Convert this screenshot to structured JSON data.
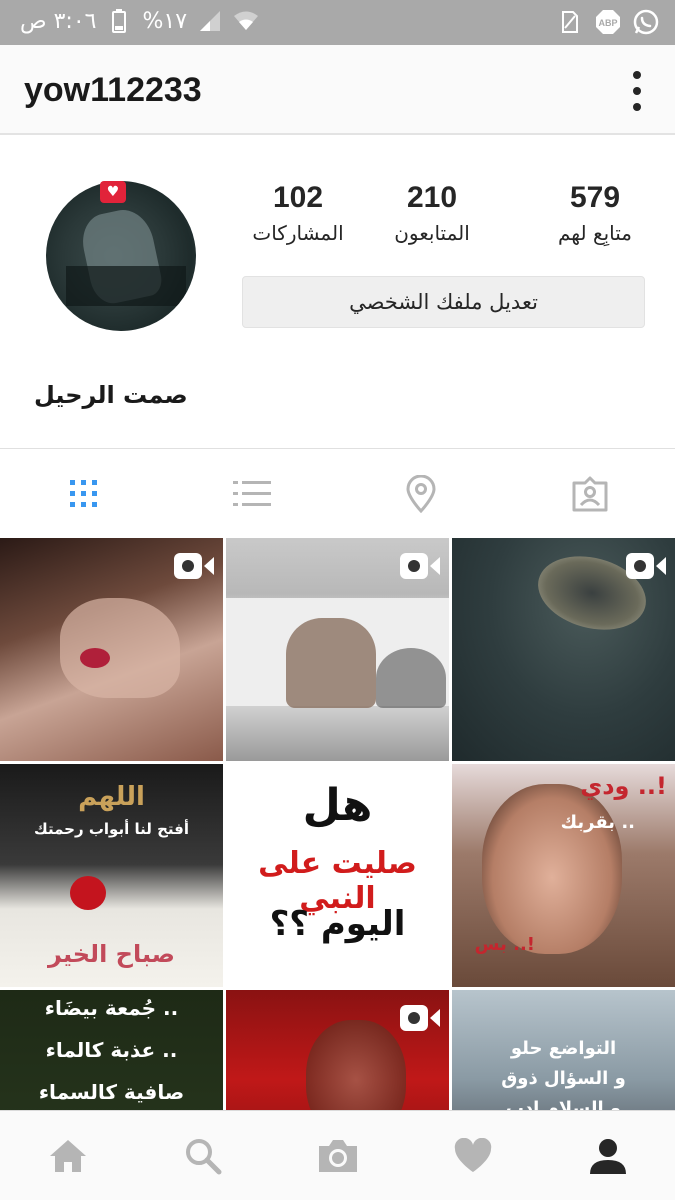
{
  "status_bar": {
    "time": "٣:٠٦ ص",
    "battery": "%١٧",
    "icons": [
      "battery-icon",
      "cell-signal-icon",
      "wifi-icon",
      "sim-icon",
      "adblock-icon",
      "whatsapp-icon"
    ],
    "abp_label": "ABP"
  },
  "header": {
    "username": "yow112233",
    "menu_icon": "more-vertical-icon"
  },
  "profile": {
    "stats": [
      {
        "value": "579",
        "label": "متابِع لهم"
      },
      {
        "value": "210",
        "label": "المتابعون"
      },
      {
        "value": "102",
        "label": "المشاركات"
      }
    ],
    "edit_button_label": "تعديل ملفك الشخصي",
    "full_name": "صمت الرحيل"
  },
  "tabs": [
    {
      "icon": "grid-view-icon",
      "active": true
    },
    {
      "icon": "list-view-icon",
      "active": false
    },
    {
      "icon": "location-pin-icon",
      "active": false
    },
    {
      "icon": "tagged-photos-icon",
      "active": false
    }
  ],
  "posts": [
    {
      "type": "video",
      "caption": ""
    },
    {
      "type": "video",
      "caption": ""
    },
    {
      "type": "video",
      "caption": ""
    },
    {
      "type": "image",
      "caption_lines": [
        "اللهم",
        "أفتح لنا أبواب رحمتك",
        "صباح الخير"
      ]
    },
    {
      "type": "image",
      "caption_lines": [
        "هل",
        "صليت على النبي",
        "اليوم ؟؟"
      ]
    },
    {
      "type": "image",
      "caption_lines": [
        "ودي ..!",
        "بقربك ..",
        "بس ..!"
      ]
    },
    {
      "type": "image",
      "caption_lines": [
        "جُمعة بيضَاء ..",
        "عذبة كالماء ..",
        "صافية كالسماء"
      ]
    },
    {
      "type": "video",
      "caption": ""
    },
    {
      "type": "image",
      "caption_lines": [
        "التواضع حلو",
        "و السؤال ذوق",
        "و السلام ادب"
      ]
    }
  ],
  "bottom_nav": [
    {
      "icon": "home-icon"
    },
    {
      "icon": "search-icon"
    },
    {
      "icon": "camera-icon"
    },
    {
      "icon": "heart-icon"
    },
    {
      "icon": "profile-icon",
      "active": true
    }
  ],
  "colors": {
    "accent": "#3897f0",
    "status_bar": "#a9a9a9",
    "inactive_icon": "#b5b5b5",
    "text": "#262626"
  }
}
